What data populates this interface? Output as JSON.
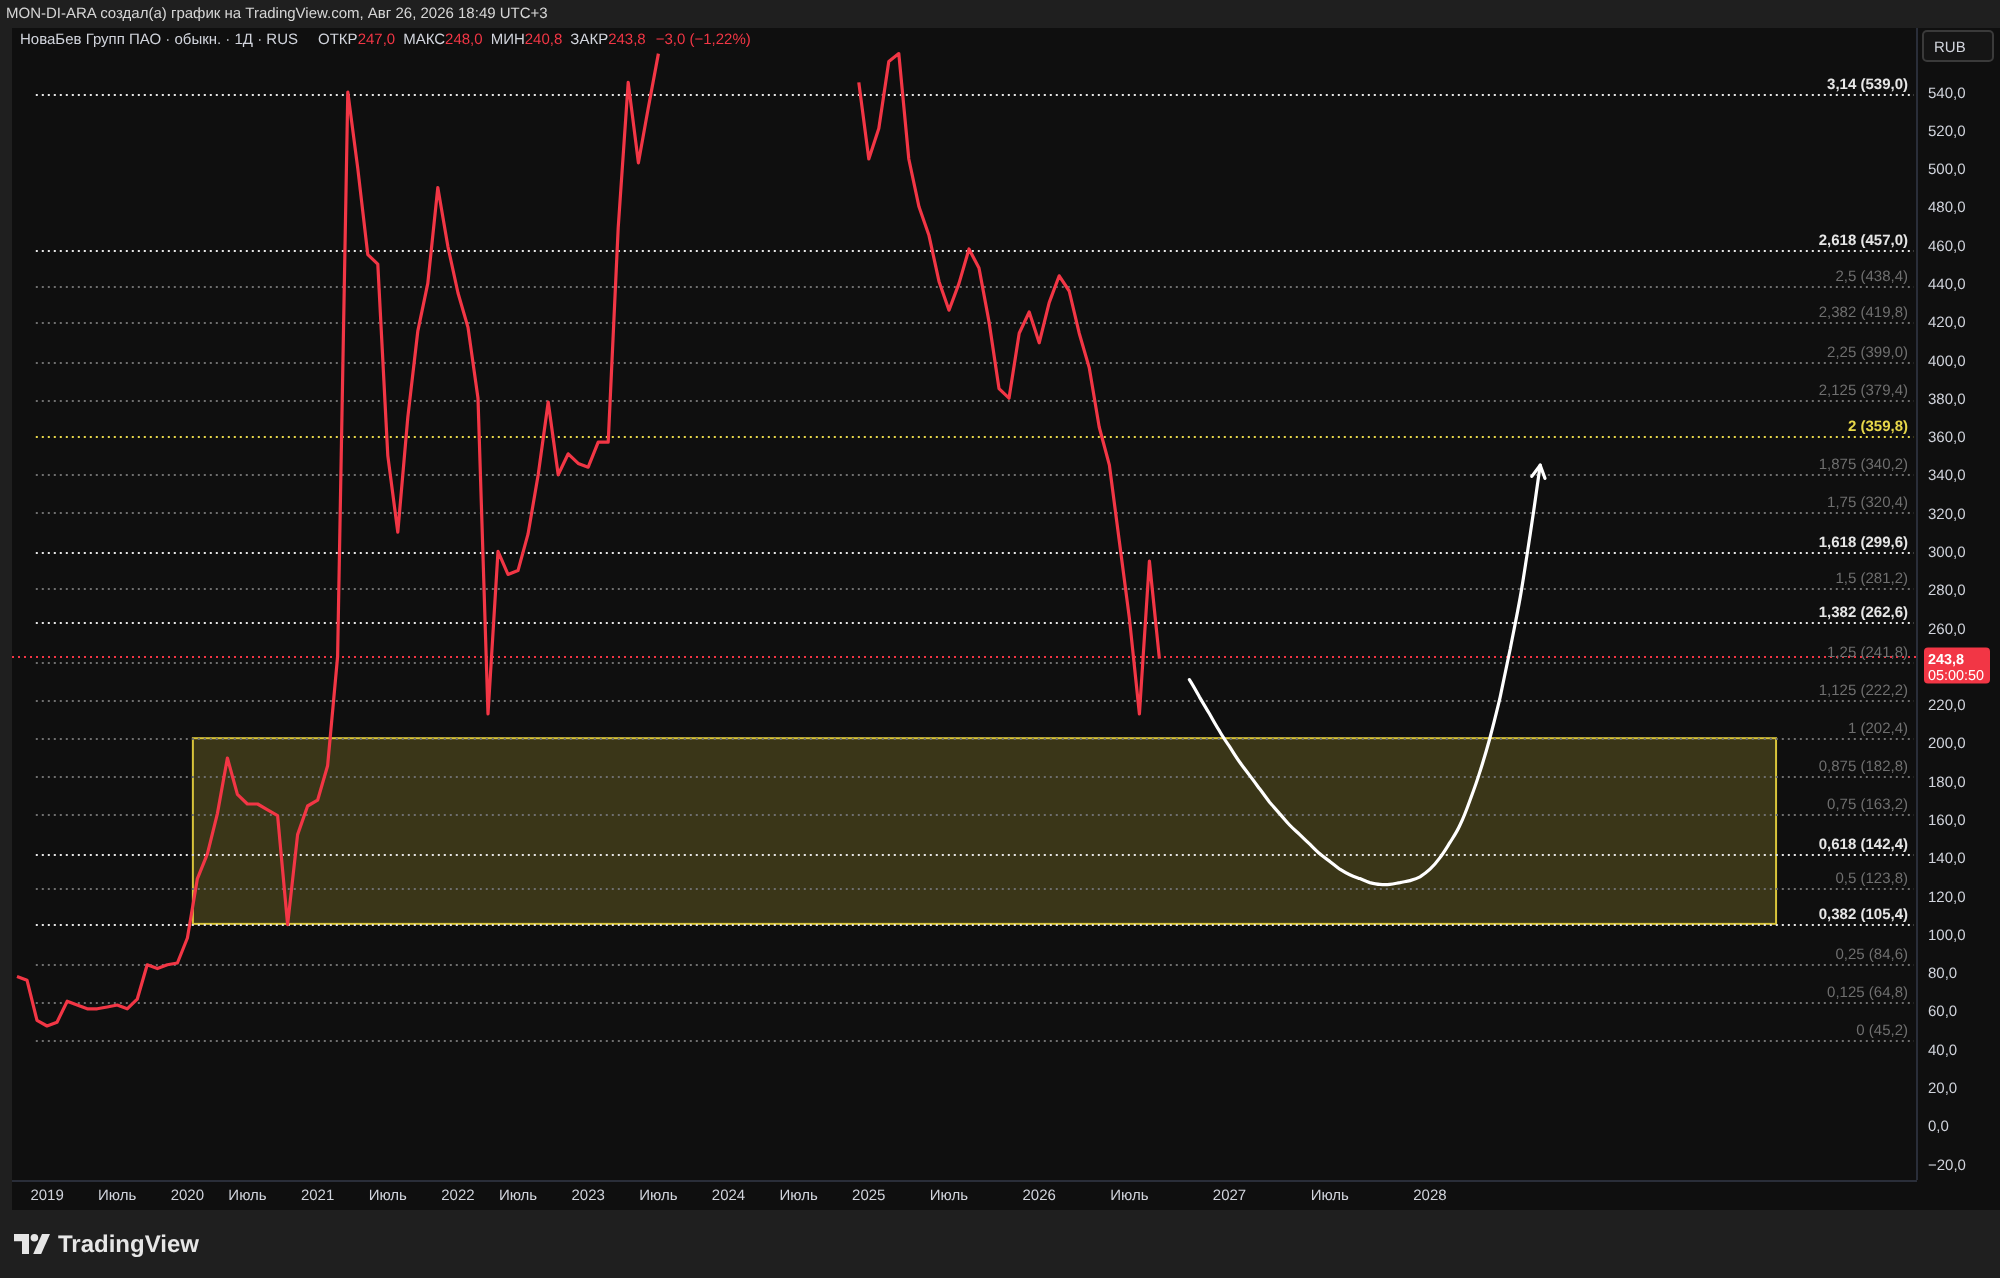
{
  "caption": {
    "text": "MON-DI-ARA создал(а) график на TradingView.com, Авг 26, 2026 18:49 UTC+3"
  },
  "legend": {
    "symbol": "НоваБев Групп ПАО · обыкн. · 1Д · RUS",
    "falling": true,
    "fields": [
      {
        "label": "ОТКР",
        "value": "247,0"
      },
      {
        "label": "МАКС",
        "value": "248,0"
      },
      {
        "label": "МИН",
        "value": "240,8"
      },
      {
        "label": "ЗАКР",
        "value": "243,8"
      }
    ],
    "change": "−3,0 (−1,22%)"
  },
  "chart": {
    "currency": "RUB",
    "last_price": {
      "value": "243,8",
      "countdown": "05:00:50"
    },
    "chart_data": {
      "type": "line",
      "categories": [
        null,
        null,
        null,
        "2019",
        null,
        null,
        null,
        null,
        null,
        null,
        "Июль",
        null,
        null,
        null,
        null,
        null,
        null,
        "2020",
        null,
        null,
        null,
        null,
        null,
        "Июль",
        null,
        null,
        null,
        null,
        null,
        null,
        "2021",
        null,
        null,
        null,
        null,
        null,
        null,
        "Июль",
        null,
        null,
        null,
        null,
        null,
        null,
        "2022",
        null,
        null,
        null,
        null,
        null,
        "Июль",
        null,
        null,
        null,
        null,
        null,
        null,
        "2023",
        null,
        null,
        null,
        null,
        null,
        null,
        "Июль",
        null,
        null,
        null,
        null,
        null,
        null,
        "2024",
        null,
        null,
        null,
        null,
        null,
        null,
        "Июль",
        null,
        null,
        null,
        null,
        null,
        null,
        "2025",
        null,
        null,
        null,
        null,
        null,
        null,
        null,
        "Июль",
        null,
        null,
        null,
        null,
        null,
        null,
        null,
        null,
        "2026",
        null,
        null,
        null,
        null,
        null,
        null,
        null,
        null,
        "Июль",
        null,
        null,
        null,
        null,
        null,
        null,
        null,
        null,
        null,
        "2027",
        null,
        null,
        null,
        null,
        null,
        null,
        null,
        null,
        null,
        "Июль",
        null,
        null,
        null,
        null,
        null,
        null,
        null,
        null,
        null,
        "2028",
        null,
        null,
        null,
        null,
        null,
        null,
        null,
        null,
        null,
        null,
        null,
        null,
        null,
        null,
        null,
        null,
        null,
        null,
        null,
        null,
        null,
        null,
        null,
        null,
        null,
        null,
        null,
        null,
        null,
        null,
        null,
        null,
        null,
        null,
        null,
        null,
        null,
        null,
        null,
        null,
        null,
        null,
        null,
        null,
        null,
        null,
        null,
        null
      ],
      "series": [
        {
          "color": "#f23645",
          "values": [
            78,
            76,
            55,
            52,
            54,
            65,
            63,
            61,
            61,
            62,
            63,
            61,
            66,
            84,
            82,
            84,
            85,
            98,
            129,
            142,
            163,
            192,
            173,
            168,
            168,
            165,
            162,
            105,
            152,
            167,
            170,
            188,
            245,
            540,
            500,
            455,
            450,
            350,
            310,
            370,
            415,
            440,
            490,
            459,
            435,
            417,
            380,
            215,
            300,
            288,
            290,
            309,
            340,
            378,
            340,
            351,
            346,
            344,
            357,
            357,
            469,
            545,
            503,
            532,
            560,
            null,
            null,
            null,
            null,
            null,
            null,
            null,
            null,
            null,
            null,
            null,
            null,
            null,
            null,
            null,
            null,
            null,
            null,
            null,
            545,
            505,
            521,
            556,
            560,
            505,
            480,
            465,
            441,
            426,
            440,
            458,
            448,
            420,
            385,
            380,
            414,
            425,
            409,
            430,
            444,
            436,
            414,
            396,
            365,
            345,
            305,
            265,
            215,
            295,
            244,
            null,
            null,
            null,
            null,
            null,
            null,
            null,
            null,
            null,
            null,
            null,
            null,
            null,
            null,
            null,
            null,
            null,
            null,
            null,
            null,
            null,
            null,
            null,
            null,
            null,
            null,
            null,
            null,
            null,
            null,
            null,
            null,
            null,
            null,
            null,
            null,
            null,
            null,
            null,
            null,
            null,
            null,
            null,
            null,
            null,
            null,
            null,
            null,
            null,
            null,
            null,
            null,
            null,
            null,
            null,
            null,
            null,
            null,
            null,
            null,
            null,
            null,
            null,
            null,
            null,
            null,
            null,
            null,
            null,
            null,
            null,
            null,
            null,
            null,
            null
          ]
        },
        {
          "color": "#ffffff",
          "values": [
            null,
            null,
            null,
            null,
            null,
            null,
            null,
            null,
            null,
            null,
            null,
            null,
            null,
            null,
            null,
            null,
            null,
            null,
            null,
            null,
            null,
            null,
            null,
            null,
            null,
            null,
            null,
            null,
            null,
            null,
            null,
            null,
            null,
            null,
            null,
            null,
            null,
            null,
            null,
            null,
            null,
            null,
            null,
            null,
            null,
            null,
            null,
            null,
            null,
            null,
            null,
            null,
            null,
            null,
            null,
            null,
            null,
            null,
            null,
            null,
            null,
            null,
            null,
            null,
            null,
            null,
            null,
            null,
            null,
            null,
            null,
            null,
            null,
            null,
            null,
            null,
            null,
            null,
            null,
            null,
            null,
            null,
            null,
            null,
            null,
            null,
            null,
            null,
            null,
            null,
            null,
            null,
            null,
            null,
            null,
            null,
            null,
            null,
            null,
            null,
            null,
            null,
            null,
            null,
            null,
            null,
            null,
            null,
            null,
            null,
            null,
            null,
            null,
            null,
            null,
            null,
            null,
            233,
            224,
            215,
            206,
            198,
            190,
            183,
            176,
            169,
            163,
            157,
            152,
            147,
            142,
            138,
            134,
            131,
            129,
            127,
            126,
            126,
            127,
            128,
            130,
            134,
            140,
            148,
            157,
            170,
            185,
            203,
            224,
            249,
            276,
            309,
            345,
            null,
            null,
            null,
            null,
            null,
            null,
            null,
            null,
            null,
            null,
            null,
            null,
            null,
            null,
            null,
            null,
            null,
            null,
            null,
            null,
            null,
            null,
            null,
            null,
            null,
            null,
            null,
            null,
            null,
            null,
            null,
            null,
            null,
            null,
            null,
            null,
            null
          ]
        }
      ],
      "ylim": [
        -28.4,
        573.4
      ],
      "yticks": [
        {
          "value": 540,
          "label": "540,0"
        },
        {
          "value": 520,
          "label": "520,0"
        },
        {
          "value": 500,
          "label": "500,0"
        },
        {
          "value": 480,
          "label": "480,0"
        },
        {
          "value": 460,
          "label": "460,0"
        },
        {
          "value": 440,
          "label": "440,0"
        },
        {
          "value": 420,
          "label": "420,0"
        },
        {
          "value": 400,
          "label": "400,0"
        },
        {
          "value": 380,
          "label": "380,0"
        },
        {
          "value": 360,
          "label": "360,0"
        },
        {
          "value": 340,
          "label": "340,0"
        },
        {
          "value": 320,
          "label": "320,0"
        },
        {
          "value": 300,
          "label": "300,0"
        },
        {
          "value": 280,
          "label": "280,0"
        },
        {
          "value": 260,
          "label": "260,0"
        },
        {
          "value": 220,
          "label": "220,0"
        },
        {
          "value": 200,
          "label": "200,0"
        },
        {
          "value": 180,
          "label": "180,0"
        },
        {
          "value": 160,
          "label": "160,0"
        },
        {
          "value": 140,
          "label": "140,0"
        },
        {
          "value": 120,
          "label": "120,0"
        },
        {
          "value": 100,
          "label": "100,0"
        },
        {
          "value": 80,
          "label": "80,0"
        },
        {
          "value": 60,
          "label": "60,0"
        },
        {
          "value": 40,
          "label": "40,0"
        },
        {
          "value": 20,
          "label": "20,0"
        },
        {
          "value": 0,
          "label": "0,0"
        },
        {
          "value": -20,
          "label": "−20,0"
        }
      ],
      "bands": [
        {
          "axis": "y",
          "from": 105.4,
          "to": 202.4,
          "color": "#d8c43a"
        }
      ],
      "ref_lines": [
        {
          "axis": "y",
          "value": 539.0,
          "label": "3,14 (539,0)",
          "color": "#e6e6e6"
        },
        {
          "axis": "y",
          "value": 457.0,
          "label": "2,618 (457,0)",
          "color": "#e6e6e6"
        },
        {
          "axis": "y",
          "value": 438.4,
          "label": "2,5 (438,4)",
          "color": "#6f6f6f"
        },
        {
          "axis": "y",
          "value": 419.8,
          "label": "2,382 (419,8)",
          "color": "#6f6f6f"
        },
        {
          "axis": "y",
          "value": 399.0,
          "label": "2,25 (399,0)",
          "color": "#6f6f6f"
        },
        {
          "axis": "y",
          "value": 379.4,
          "label": "2,125 (379,4)",
          "color": "#6f6f6f"
        },
        {
          "axis": "y",
          "value": 359.8,
          "label": "2 (359,8)",
          "color": "#e8d84a"
        },
        {
          "axis": "y",
          "value": 340.2,
          "label": "1,875 (340,2)",
          "color": "#6f6f6f"
        },
        {
          "axis": "y",
          "value": 320.4,
          "label": "1,75 (320,4)",
          "color": "#6f6f6f"
        },
        {
          "axis": "y",
          "value": 299.6,
          "label": "1,618 (299,6)",
          "color": "#e6e6e6"
        },
        {
          "axis": "y",
          "value": 281.2,
          "label": "1,5 (281,2)",
          "color": "#6f6f6f"
        },
        {
          "axis": "y",
          "value": 262.6,
          "label": "1,382 (262,6)",
          "color": "#e6e6e6"
        },
        {
          "axis": "y",
          "value": 243.8,
          "color": "#f23645"
        },
        {
          "axis": "y",
          "value": 241.8,
          "label": "1,25 (241,8)",
          "color": "#6f6f6f"
        },
        {
          "axis": "y",
          "value": 222.2,
          "label": "1,125 (222,2)",
          "color": "#6f6f6f"
        },
        {
          "axis": "y",
          "value": 202.4,
          "label": "1 (202,4)",
          "color": "#6f6f6f"
        },
        {
          "axis": "y",
          "value": 182.8,
          "label": "0,875 (182,8)",
          "color": "#6f6f6f"
        },
        {
          "axis": "y",
          "value": 163.2,
          "label": "0,75 (163,2)",
          "color": "#6f6f6f"
        },
        {
          "axis": "y",
          "value": 142.4,
          "label": "0,618 (142,4)",
          "color": "#e6e6e6"
        },
        {
          "axis": "y",
          "value": 123.8,
          "label": "0,5 (123,8)",
          "color": "#6f6f6f"
        },
        {
          "axis": "y",
          "value": 105.4,
          "label": "0,382 (105,4)",
          "color": "#e6e6e6"
        },
        {
          "axis": "y",
          "value": 84.6,
          "label": "0,25 (84,6)",
          "color": "#6f6f6f"
        },
        {
          "axis": "y",
          "value": 64.8,
          "label": "0,125 (64,8)",
          "color": "#6f6f6f"
        },
        {
          "axis": "y",
          "value": 45.2,
          "label": "0 (45,2)",
          "color": "#6f6f6f"
        }
      ]
    }
  },
  "footer": {
    "brand": "TradingView"
  }
}
